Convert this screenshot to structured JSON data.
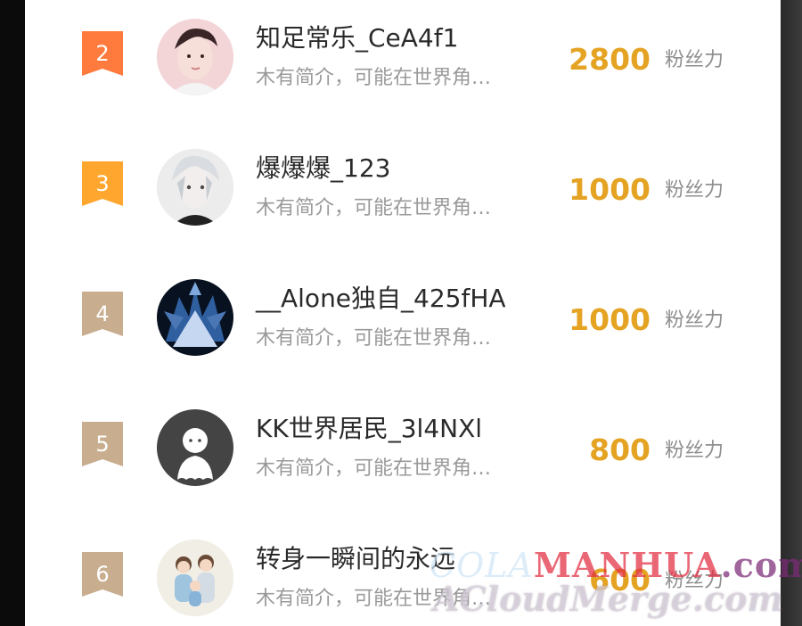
{
  "fan_list": {
    "items": [
      {
        "rank": "2",
        "rank_color": "#ff7a3d",
        "name": "知足常乐_CeA4f1",
        "intro": "木有简介，可能在世界角…",
        "count": "2800",
        "unit": "粉丝力",
        "avatar_icon": "boy-avatar-icon"
      },
      {
        "rank": "3",
        "rank_color": "#ffa62e",
        "name": "爆爆爆_123",
        "intro": "木有简介，可能在世界角…",
        "count": "1000",
        "unit": "粉丝力",
        "avatar_icon": "anime-white-hair-avatar-icon"
      },
      {
        "rank": "4",
        "rank_color": "#c8ad8f",
        "name": "__Alone独自_425fHA",
        "intro": "木有简介，可能在世界角…",
        "count": "1000",
        "unit": "粉丝力",
        "avatar_icon": "dark-blue-armor-avatar-icon"
      },
      {
        "rank": "5",
        "rank_color": "#c8ad8f",
        "name": "KK世界居民_3l4NXl",
        "intro": "木有简介，可能在世界角…",
        "count": "800",
        "unit": "粉丝力",
        "avatar_icon": "default-ghost-avatar-icon"
      },
      {
        "rank": "6",
        "rank_color": "#c8ad8f",
        "name": "转身一瞬间的永远",
        "intro": "木有简介，可能在世界角…",
        "count": "600",
        "unit": "粉丝力",
        "avatar_icon": "family-cartoon-avatar-icon"
      }
    ]
  },
  "watermark": {
    "line1_a": "COLA",
    "line1_b": "MANHUA",
    "line1_c": ".com",
    "line2": "ACloudMerge.com"
  },
  "colors": {
    "count": "#e4a323",
    "name": "#2a2a2a",
    "intro": "#9a9a9a",
    "unit": "#8f8f8f"
  }
}
